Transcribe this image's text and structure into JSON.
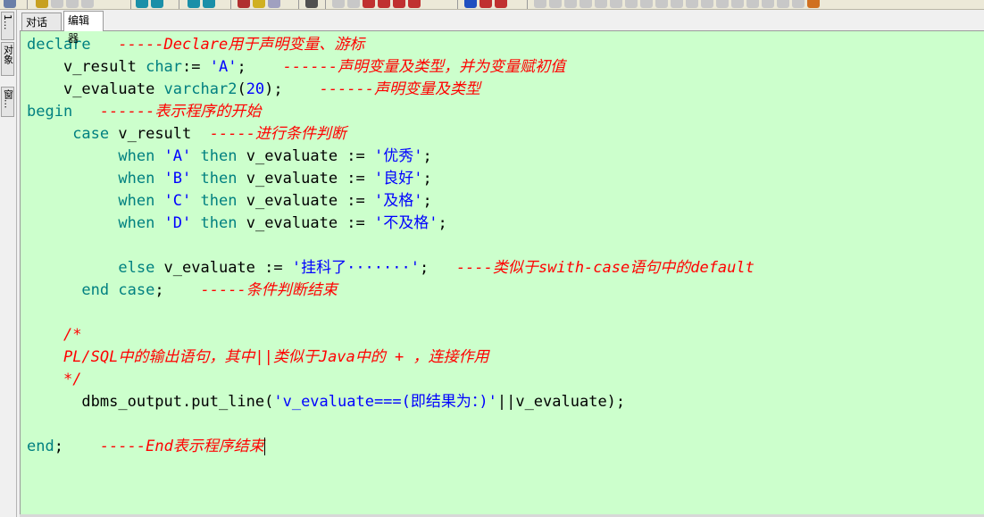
{
  "tabs": [
    {
      "label": "对话框",
      "active": false
    },
    {
      "label": "编辑器",
      "active": true
    }
  ],
  "side_tabs": [
    "1...",
    "对象",
    "窗..."
  ],
  "editor_bg": "#ccffcc",
  "code": {
    "l1": {
      "kw": "declare",
      "cm": "-----Declare用于声明变量、游标"
    },
    "l2": {
      "id": "v_result ",
      "kw": "char",
      "op": ":= ",
      "str": "'A'",
      "end": ";",
      "cm": "------声明变量及类型，并为变量赋初值"
    },
    "l3": {
      "id": "v_evaluate ",
      "kw": "varchar2",
      "open": "(",
      "num": "20",
      "close": ");",
      "cm": "------声明变量及类型"
    },
    "l4": {
      "kw": "begin",
      "cm": "------表示程序的开始"
    },
    "l5": {
      "kw": "case",
      "id": " v_result",
      "cm": "-----进行条件判断"
    },
    "l6": {
      "kw1": "when",
      "str1": "'A'",
      "kw2": "then",
      "rest": " v_evaluate := ",
      "str2": "'优秀'",
      "end": ";"
    },
    "l7": {
      "kw1": "when",
      "str1": "'B'",
      "kw2": "then",
      "rest": " v_evaluate := ",
      "str2": "'良好'",
      "end": ";"
    },
    "l8": {
      "kw1": "when",
      "str1": "'C'",
      "kw2": "then",
      "rest": " v_evaluate := ",
      "str2": "'及格'",
      "end": ";"
    },
    "l9": {
      "kw1": "when",
      "str1": "'D'",
      "kw2": "then",
      "rest": " v_evaluate := ",
      "str2": "'不及格'",
      "end": ";"
    },
    "l10": {
      "kw": "else",
      "rest": " v_evaluate := ",
      "str": "'挂科了·······'",
      "end": ";",
      "cm": "----类似于swith-case语句中的default"
    },
    "l11": {
      "kw": "end case",
      "end": ";",
      "cm": "-----条件判断结束"
    },
    "l12": {
      "cm": "/*"
    },
    "l13": {
      "cm": "PL/SQL中的输出语句，其中||类似于Java中的 + ，连接作用"
    },
    "l14": {
      "cm": "*/"
    },
    "l15": {
      "pre": "dbms_output.put_line(",
      "str": "'v_evaluate===(即结果为：)'",
      "rest": "||v_evaluate);"
    },
    "l16": {
      "kw": "end",
      "end": ";",
      "cm": "-----End表示程序结束"
    }
  }
}
